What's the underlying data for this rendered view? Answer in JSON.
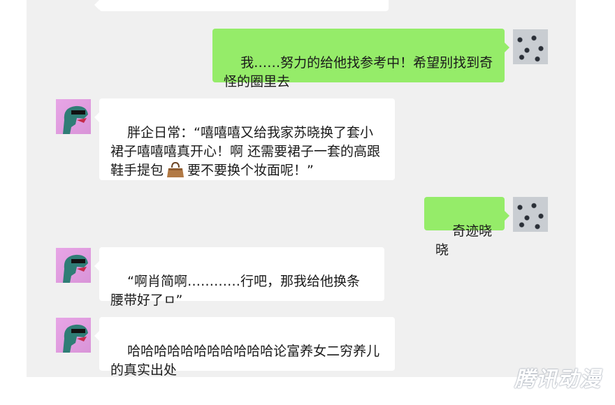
{
  "messages": [
    {
      "side": "out",
      "text": "我……努力的给他找参考中！希望别找到奇怪的圈里去"
    },
    {
      "side": "in",
      "text_before": "胖企日常：“嘻嘻嘻又给我家苏晓换了套小裙子嘻嘻嘻真开心！啊 还需要裙子一套的高跟鞋手提包",
      "text_after": "要不要换个妆面呢！”",
      "icon": "handbag-icon"
    },
    {
      "side": "out",
      "text": "奇迹晓晓"
    },
    {
      "side": "in",
      "text": "“啊肖简啊…………行吧，那我给他换条腰带好了ㅁ”"
    },
    {
      "side": "in",
      "text": "哈哈哈哈哈哈哈哈哈哈哈论富养女二穷养儿的真实出处"
    }
  ],
  "watermark": "腾讯动漫",
  "colors": {
    "chat_bg": "#f0f0f0",
    "outgoing": "#95ec69",
    "incoming": "#ffffff"
  }
}
